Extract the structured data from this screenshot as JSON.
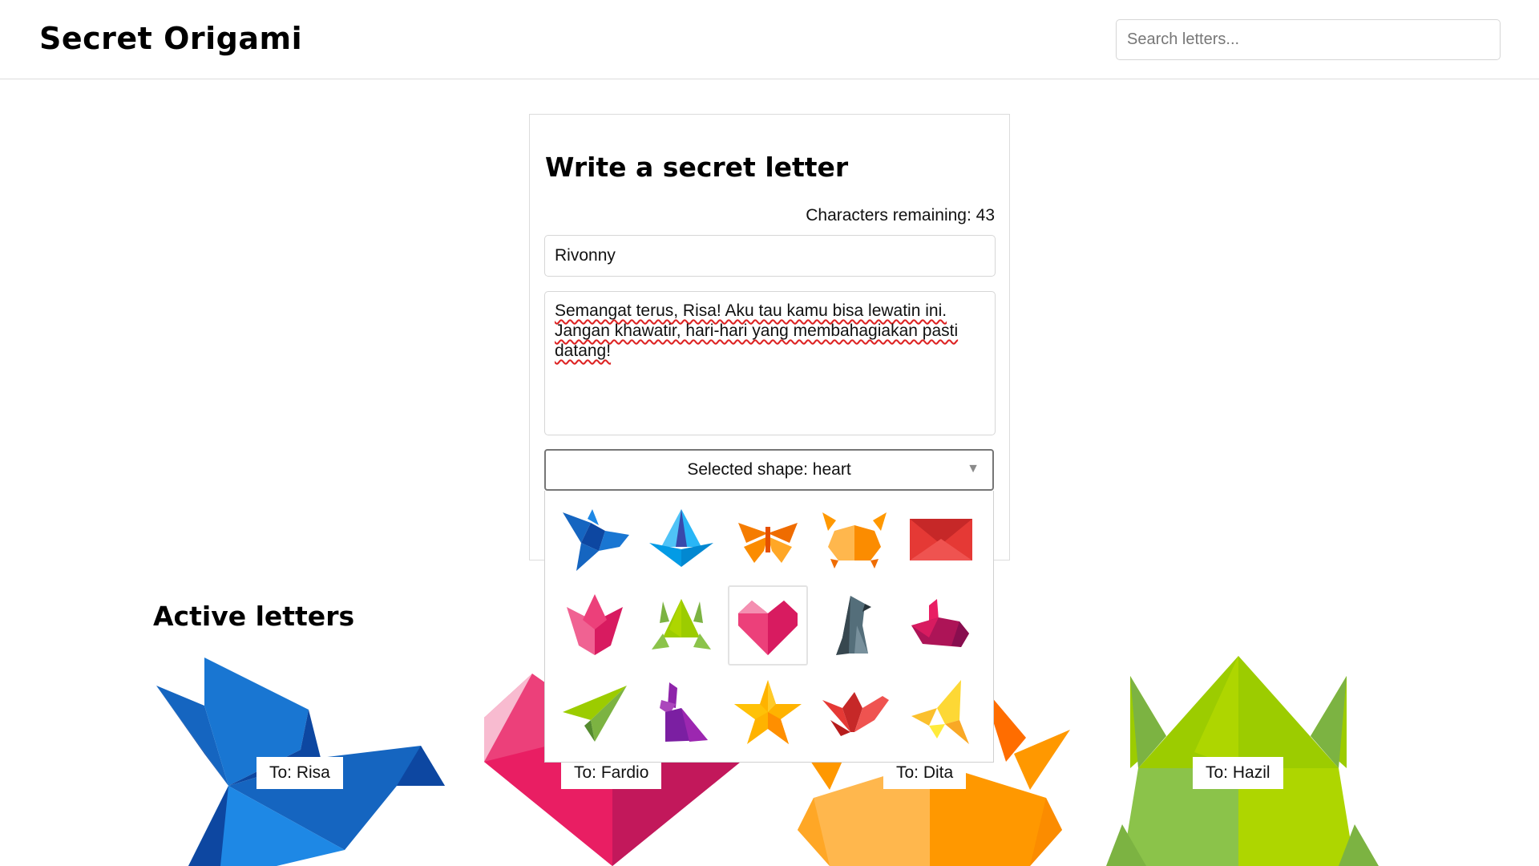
{
  "header": {
    "logo": "Secret Origami",
    "search_placeholder": "Search letters..."
  },
  "form": {
    "title": "Write a secret letter",
    "chars_remaining": "Characters remaining: 43",
    "name_value": "Rivonny",
    "message_value": "Semangat terus, Risa! Aku tau kamu bisa lewatin ini. Jangan khawatir, hari-hari yang membahagiakan pasti datang!",
    "shape_select_label": "Selected shape: heart",
    "selected_shape": "heart"
  },
  "shapes": [
    {
      "name": "bird",
      "icon": "bird-icon"
    },
    {
      "name": "boat",
      "icon": "boat-icon"
    },
    {
      "name": "butterfly",
      "icon": "butterfly-icon"
    },
    {
      "name": "crab",
      "icon": "crab-icon"
    },
    {
      "name": "envelope",
      "icon": "envelope-icon"
    },
    {
      "name": "tulip",
      "icon": "tulip-icon"
    },
    {
      "name": "frog",
      "icon": "frog-icon"
    },
    {
      "name": "heart",
      "icon": "heart-icon"
    },
    {
      "name": "penguin",
      "icon": "penguin-icon"
    },
    {
      "name": "rabbit",
      "icon": "rabbit-icon"
    },
    {
      "name": "plane",
      "icon": "plane-icon"
    },
    {
      "name": "bunny",
      "icon": "bunny-icon"
    },
    {
      "name": "star",
      "icon": "star-icon"
    },
    {
      "name": "crane",
      "icon": "crane-icon"
    },
    {
      "name": "swallow",
      "icon": "swallow-icon"
    }
  ],
  "active": {
    "title": "Active letters",
    "letters": [
      {
        "to": "To: Risa",
        "shape": "bird"
      },
      {
        "to": "To: Fardio",
        "shape": "heart"
      },
      {
        "to": "To: Dita",
        "shape": "crab"
      },
      {
        "to": "To: Hazil",
        "shape": "frog"
      }
    ]
  },
  "colors": {
    "bird": "#1565c0",
    "heart": "#e91e63",
    "crab": "#ff9800",
    "frog": "#9ccc00"
  }
}
